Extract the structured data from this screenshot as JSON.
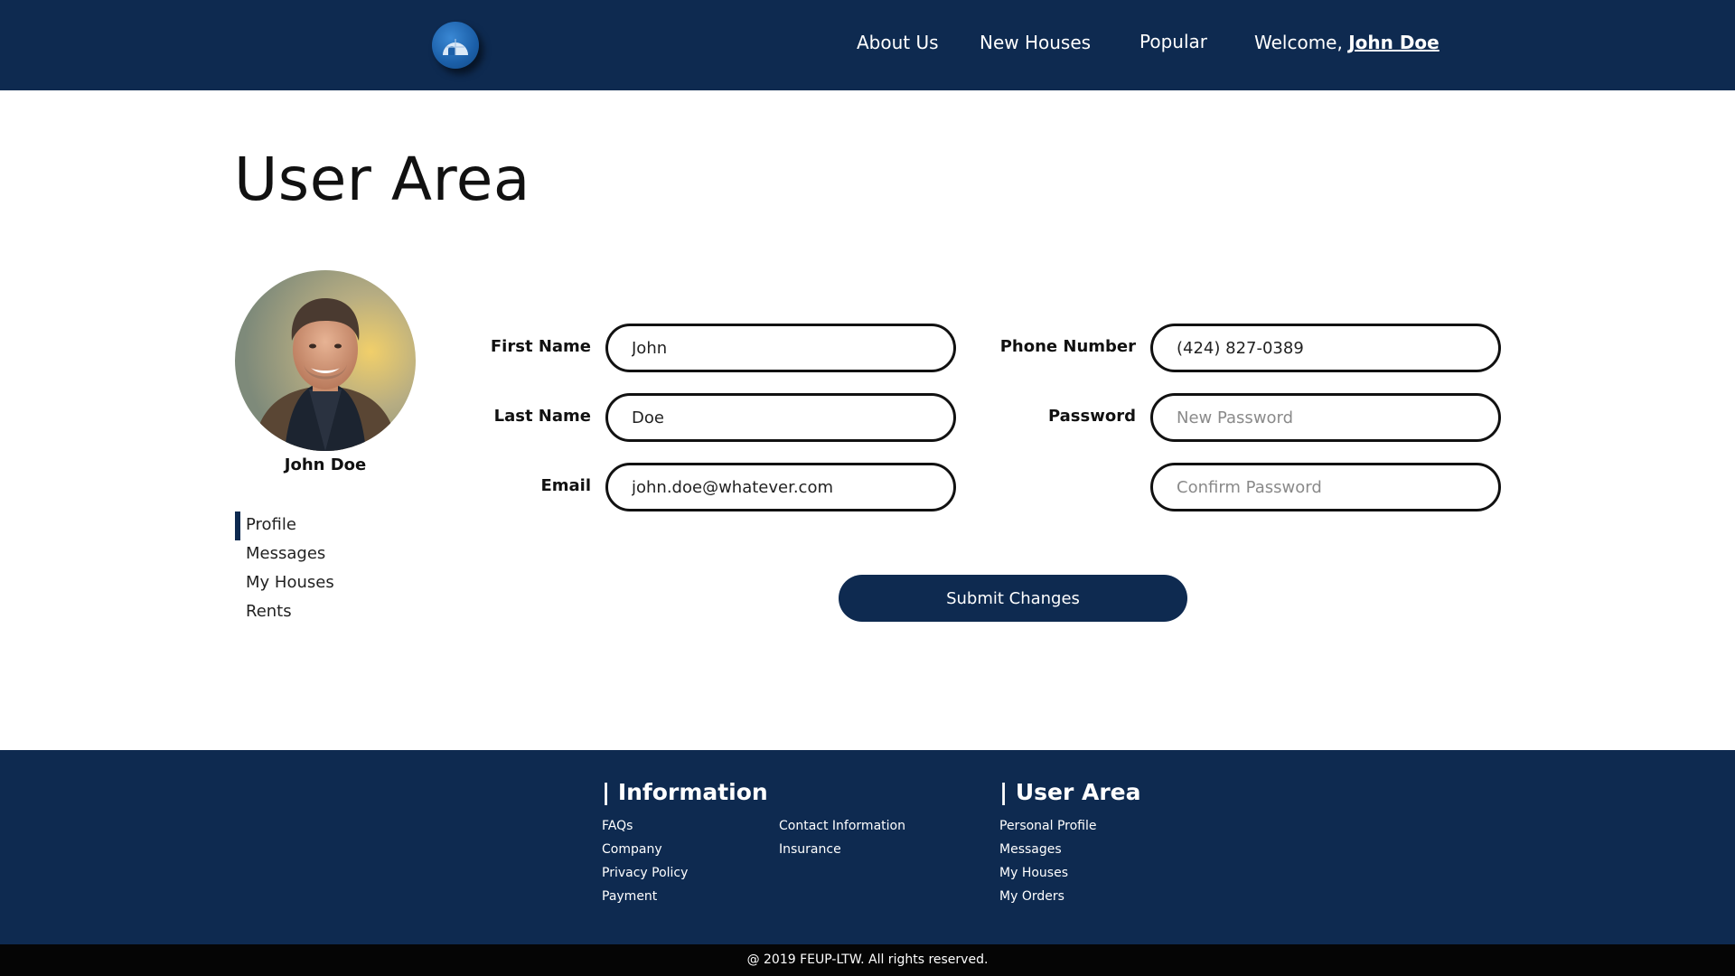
{
  "header": {
    "nav": {
      "about": "About Us",
      "new_houses": "New Houses",
      "popular": "Popular",
      "welcome_prefix": "Welcome,",
      "user_name": "John Doe"
    },
    "logo_icon": "igloo-icon",
    "background": "#0e2a50"
  },
  "main": {
    "title": "User Area",
    "profile": {
      "avatar_icon": "user-avatar",
      "name": "John Doe"
    },
    "side_nav": [
      "Profile",
      "Messages",
      "My Houses",
      "Rents"
    ],
    "side_nav_active": "Profile",
    "form": {
      "first_name": {
        "label": "First Name",
        "value": "John"
      },
      "last_name": {
        "label": "Last Name",
        "value": "Doe"
      },
      "email": {
        "label": "Email",
        "value": "john.doe@whatever.com"
      },
      "phone": {
        "label": "Phone Number",
        "value": "(424) 827-0389"
      },
      "password": {
        "label": "Password",
        "placeholder": "New Password"
      },
      "confirm_password": {
        "placeholder": "Confirm Password"
      },
      "submit_label": "Submit Changes"
    }
  },
  "footer": {
    "information": {
      "heading": "| Information",
      "col1": [
        "FAQs",
        "Company",
        "Privacy Policy",
        "Payment"
      ],
      "col2": [
        "Contact Information",
        "Insurance"
      ]
    },
    "user_area": {
      "heading": "| User Area",
      "links": [
        "Personal Profile",
        "Messages",
        "My Houses",
        "My Orders"
      ]
    },
    "copyright": "@ 2019 FEUP-LTW. All rights reserved."
  },
  "colors": {
    "brand_navy": "#0e2a50",
    "copyright_bar": "#050505",
    "logo_blue": "#1b5fa8"
  }
}
